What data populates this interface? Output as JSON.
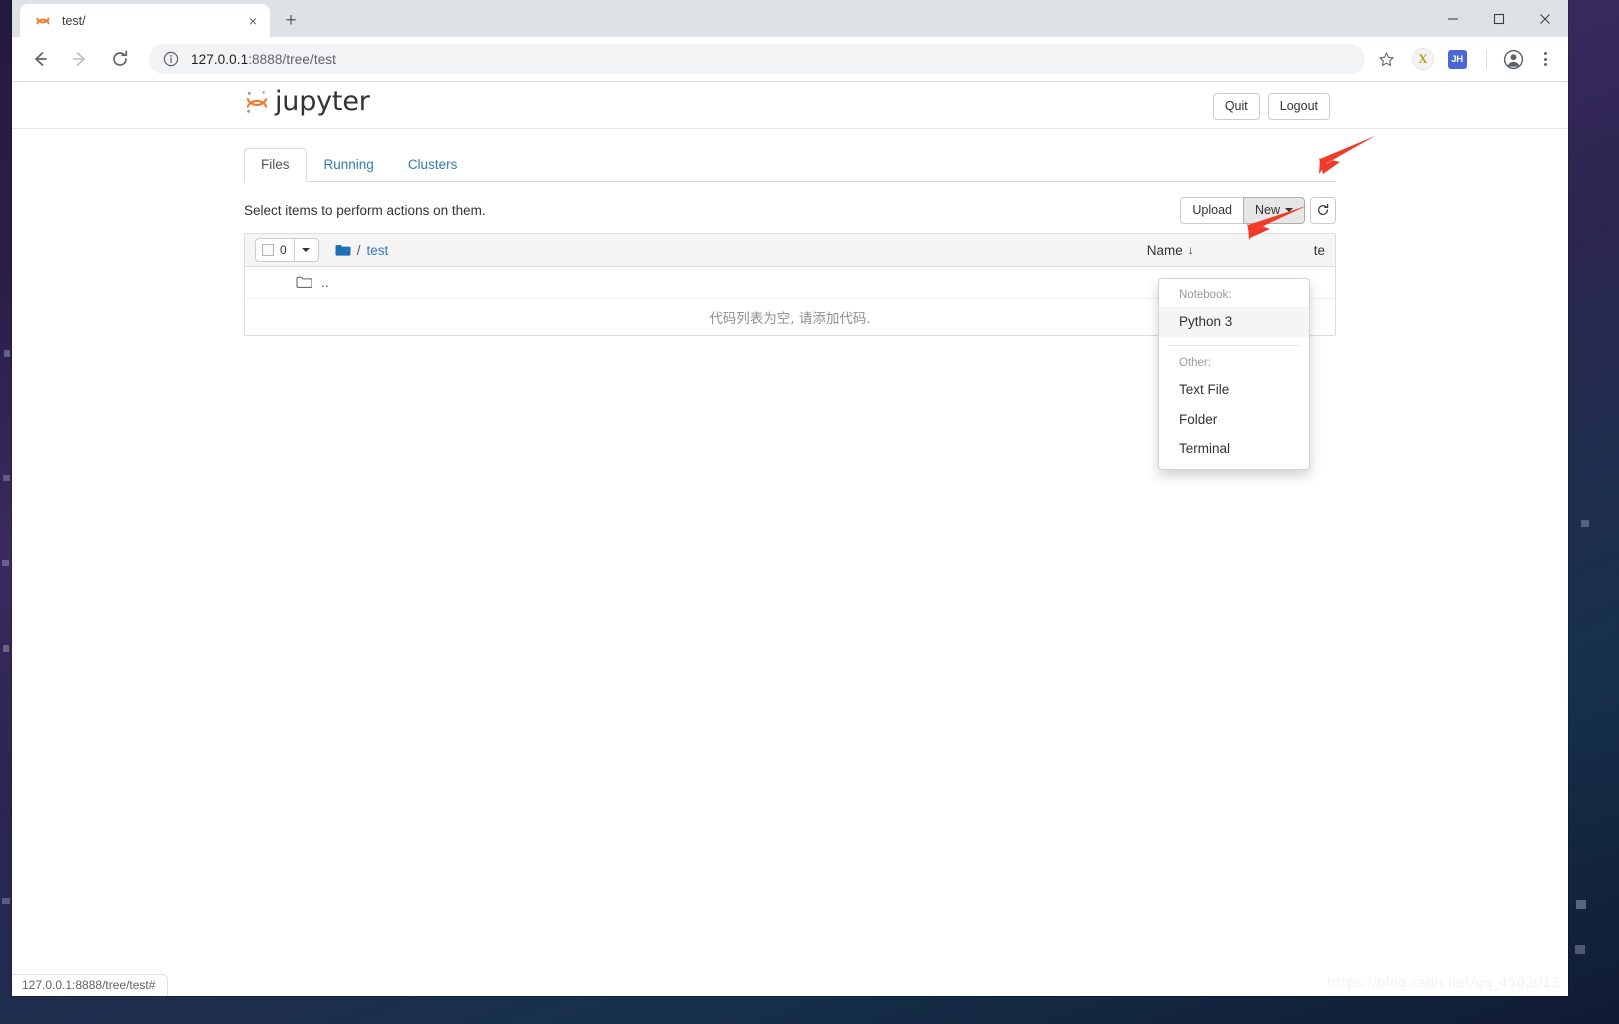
{
  "browser": {
    "tab": {
      "title": "test/",
      "favicon": "jupyter-favicon",
      "close_label": "×"
    },
    "new_tab_label": "+",
    "window_controls": {
      "minimize": "minimize-icon",
      "maximize": "maximize-icon",
      "close": "close-icon"
    },
    "nav": {
      "back": "back-arrow-icon",
      "forward": "forward-arrow-icon",
      "reload": "reload-icon"
    },
    "omnibox": {
      "security_icon": "info-circle-icon",
      "url_host": "127.0.0.1",
      "url_rest": ":8888/tree/test",
      "url_full": "127.0.0.1:8888/tree/test",
      "star_icon": "star-icon"
    },
    "extensions": [
      {
        "name": "x-extension-icon",
        "label": "X"
      },
      {
        "name": "jupyter-hub-extension-icon",
        "label": "JH"
      }
    ],
    "profile_icon": "account-circle-icon",
    "menu_icon": "kebab-menu-icon",
    "status_bubble": "127.0.0.1:8888/tree/test#"
  },
  "jupyter": {
    "logo_text": "jupyter",
    "header_buttons": [
      {
        "label": "Quit",
        "name": "quit-button"
      },
      {
        "label": "Logout",
        "name": "logout-button"
      }
    ],
    "tabs": [
      {
        "label": "Files",
        "selected": true
      },
      {
        "label": "Running",
        "selected": false
      },
      {
        "label": "Clusters",
        "selected": false
      }
    ],
    "toolbar": {
      "hint": "Select items to perform actions on them.",
      "upload_label": "Upload",
      "new_label": "New",
      "refresh_icon": "refresh-icon"
    },
    "list_header": {
      "selected_count": "0",
      "checkbox_state": "unchecked",
      "breadcrumb_root_icon": "folder-filled-icon",
      "breadcrumb_separator": "/",
      "breadcrumb_current": "test",
      "sort_name_label": "Name",
      "sort_name_arrow": "↓",
      "sort_modified_label": "te"
    },
    "rows": [
      {
        "icon": "folder-outline-icon",
        "name": ".."
      }
    ],
    "empty_message": "代码列表为空, 请添加代码."
  },
  "new_menu": {
    "notebook_header": "Notebook:",
    "notebook_items": [
      {
        "label": "Python 3",
        "highlighted": true
      }
    ],
    "other_header": "Other:",
    "other_items": [
      {
        "label": "Text File"
      },
      {
        "label": "Folder"
      },
      {
        "label": "Terminal"
      }
    ]
  },
  "annotations": {
    "arrow_color": "#f03b2b",
    "arrow_new_button": "arrow-pointing-to-new-button",
    "arrow_python3": "arrow-pointing-to-python3-item"
  },
  "watermark": "https://blog.csdn.net/qq_4502013"
}
